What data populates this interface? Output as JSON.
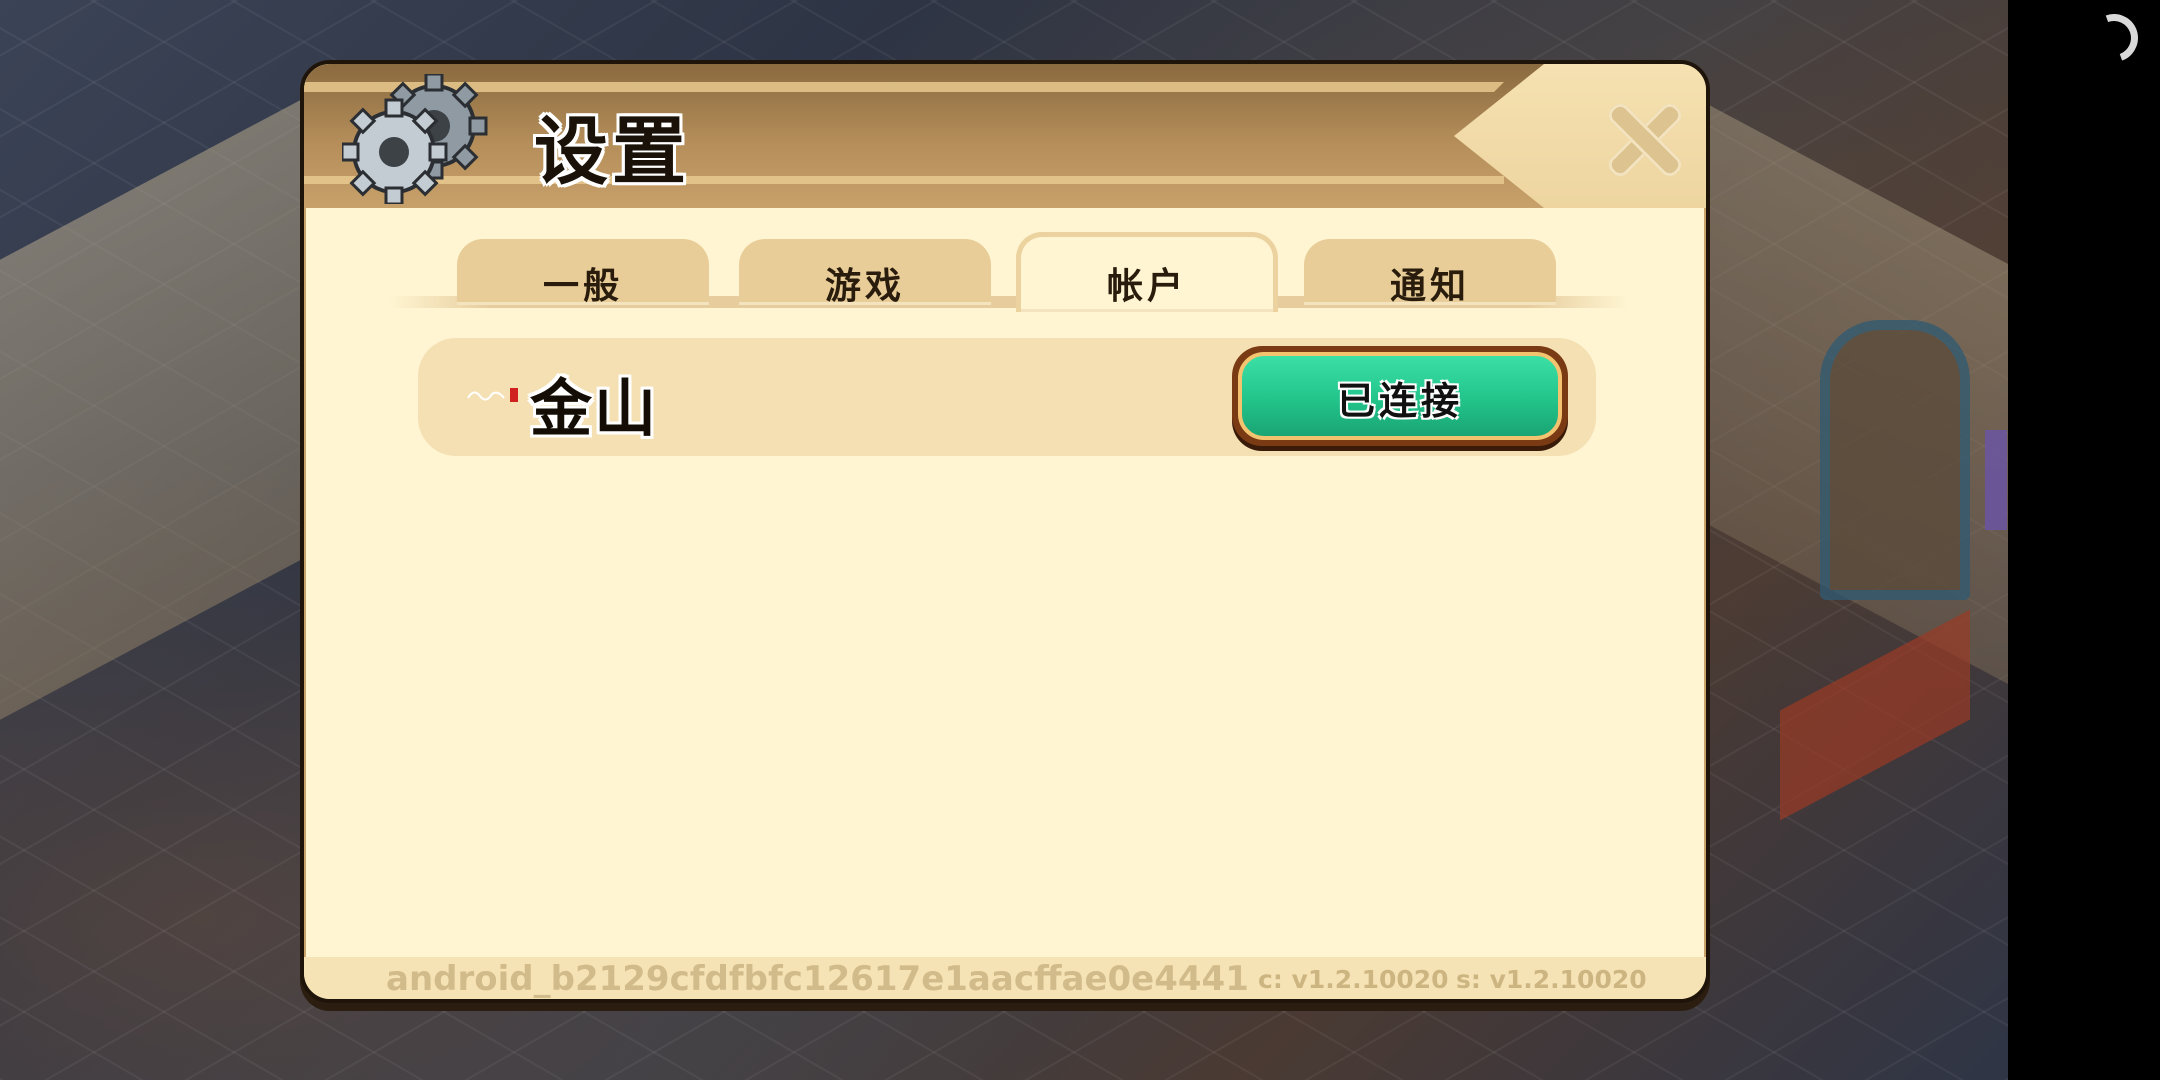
{
  "panel": {
    "title": "设置",
    "icon": "gear-icon",
    "close_icon": "close-icon"
  },
  "tabs": [
    {
      "label": "一般",
      "active": false
    },
    {
      "label": "游戏",
      "active": false
    },
    {
      "label": "帐户",
      "active": true
    },
    {
      "label": "通知",
      "active": false
    }
  ],
  "account": {
    "provider_name": "金山",
    "logo": "kingsoft-logo",
    "status_button_label": "已连接"
  },
  "footer": {
    "device_id": "android_b2129cfdfbfc12617e1aacffae0e4441",
    "client_version": "c: v1.2.10020",
    "server_version": "s: v1.2.10020"
  },
  "colors": {
    "panel_bg": "#fff5d2",
    "header_band": "#b58e5a",
    "tab_bg": "#e8cd98",
    "connected_green": "#22c48a",
    "footer_text": "#d2bb8a"
  }
}
